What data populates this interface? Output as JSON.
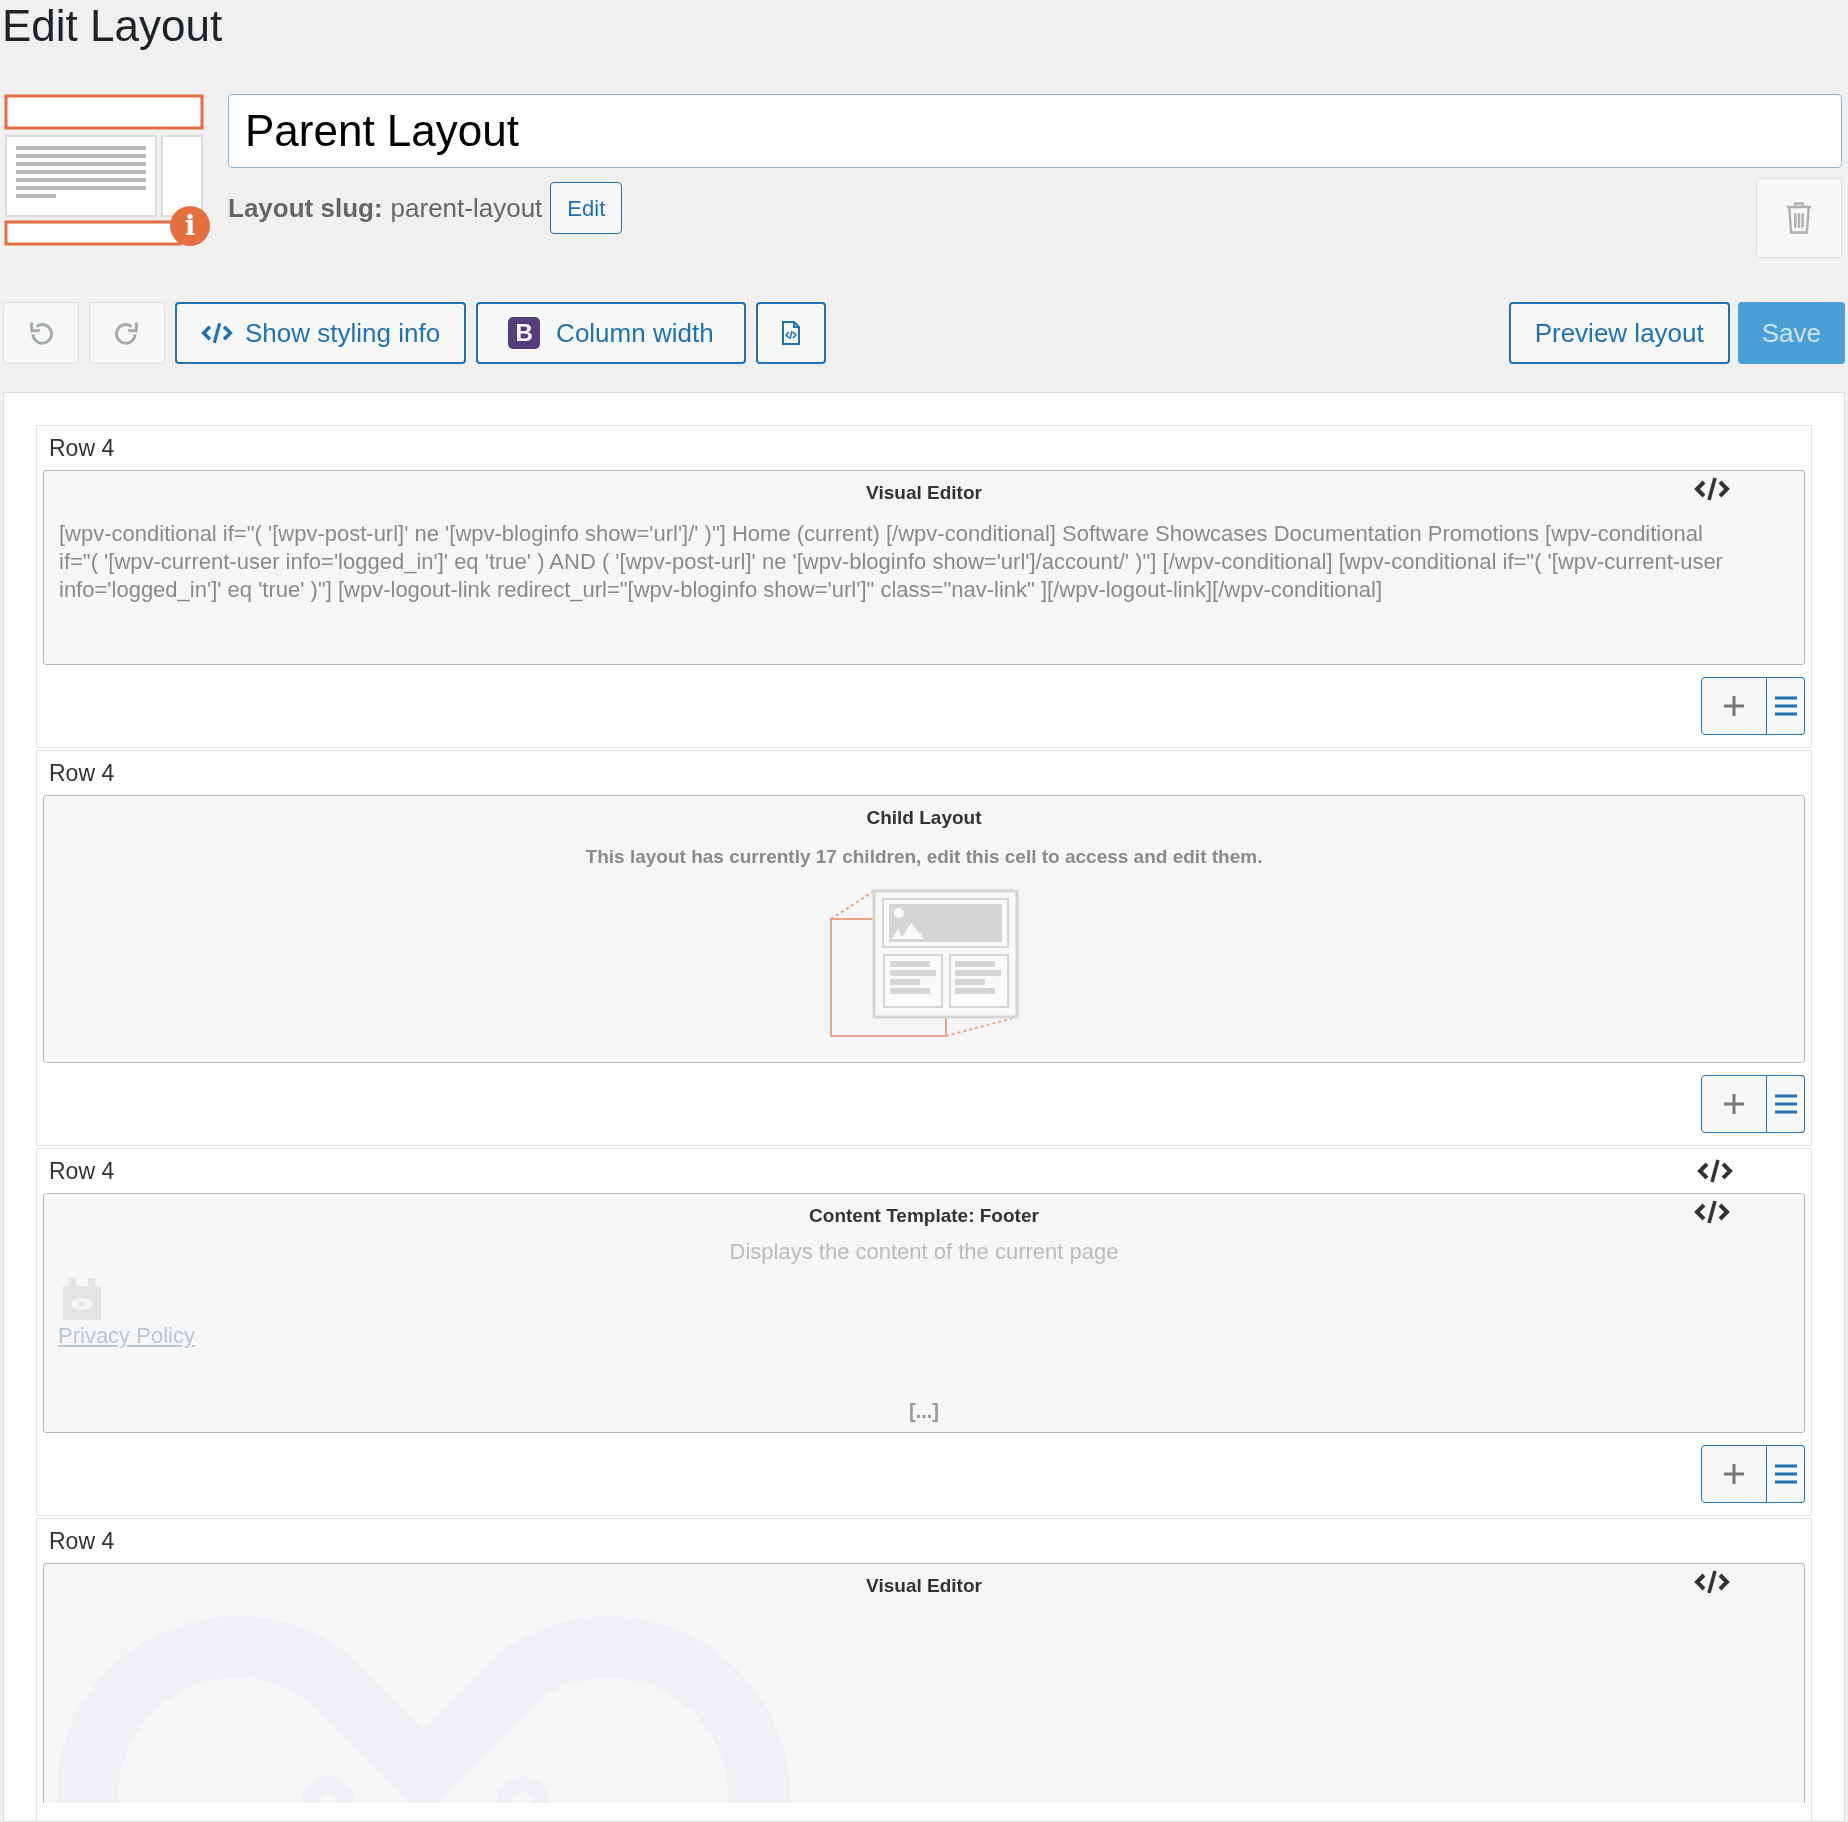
{
  "page_title": "Edit Layout",
  "layout": {
    "info_badge": "i",
    "name": "Parent Layout",
    "slug_label": "Layout slug:",
    "slug": "parent-layout",
    "slug_edit": "Edit"
  },
  "toolbar": {
    "undo": {
      "disabled": true
    },
    "redo": {
      "disabled": true
    },
    "buttons": [
      {
        "kind": "code",
        "label": "Show styling info"
      },
      {
        "kind": "bootstrap",
        "icon_letter": "B",
        "label": "Column width"
      },
      {
        "kind": "file"
      }
    ],
    "preview": "Preview layout",
    "save": {
      "label": "Save",
      "disabled": true
    }
  },
  "rows": [
    {
      "label": "Row 4",
      "code_icon": false,
      "cell": {
        "kind": "visual",
        "title": "Visual Editor",
        "text": "[wpv-conditional if=\"( '[wpv-post-url]' ne '[wpv-bloginfo show='url']/' )\"] Home (current) [/wpv-conditional] Software Showcases Documentation Promotions [wpv-conditional if=\"( '[wpv-current-user info='logged_in']' eq 'true' ) AND ( '[wpv-post-url]' ne '[wpv-bloginfo show='url']/account/' )\"] [/wpv-conditional] [wpv-conditional if=\"( '[wpv-current-user info='logged_in']' eq 'true' )\"] [wpv-logout-link redirect_url=\"[wpv-bloginfo show='url']\" class=\"nav-link\" ][/wpv-logout-link][/wpv-conditional]"
      }
    },
    {
      "label": "Row 4",
      "code_icon": false,
      "cell": {
        "kind": "child",
        "title": "Child Layout",
        "text": "This layout has currently 17 children, edit this cell to access and edit them."
      }
    },
    {
      "label": "Row 4",
      "code_icon": true,
      "cell": {
        "kind": "template",
        "title": "Content Template: Footer",
        "text": "Displays the content of the current page",
        "preview_lines": [
          "Privacy Policy"
        ],
        "more": "[...]"
      }
    },
    {
      "label": "Row 4",
      "code_icon": false,
      "cell": {
        "kind": "visual_empty",
        "title": "Visual Editor"
      }
    }
  ]
}
